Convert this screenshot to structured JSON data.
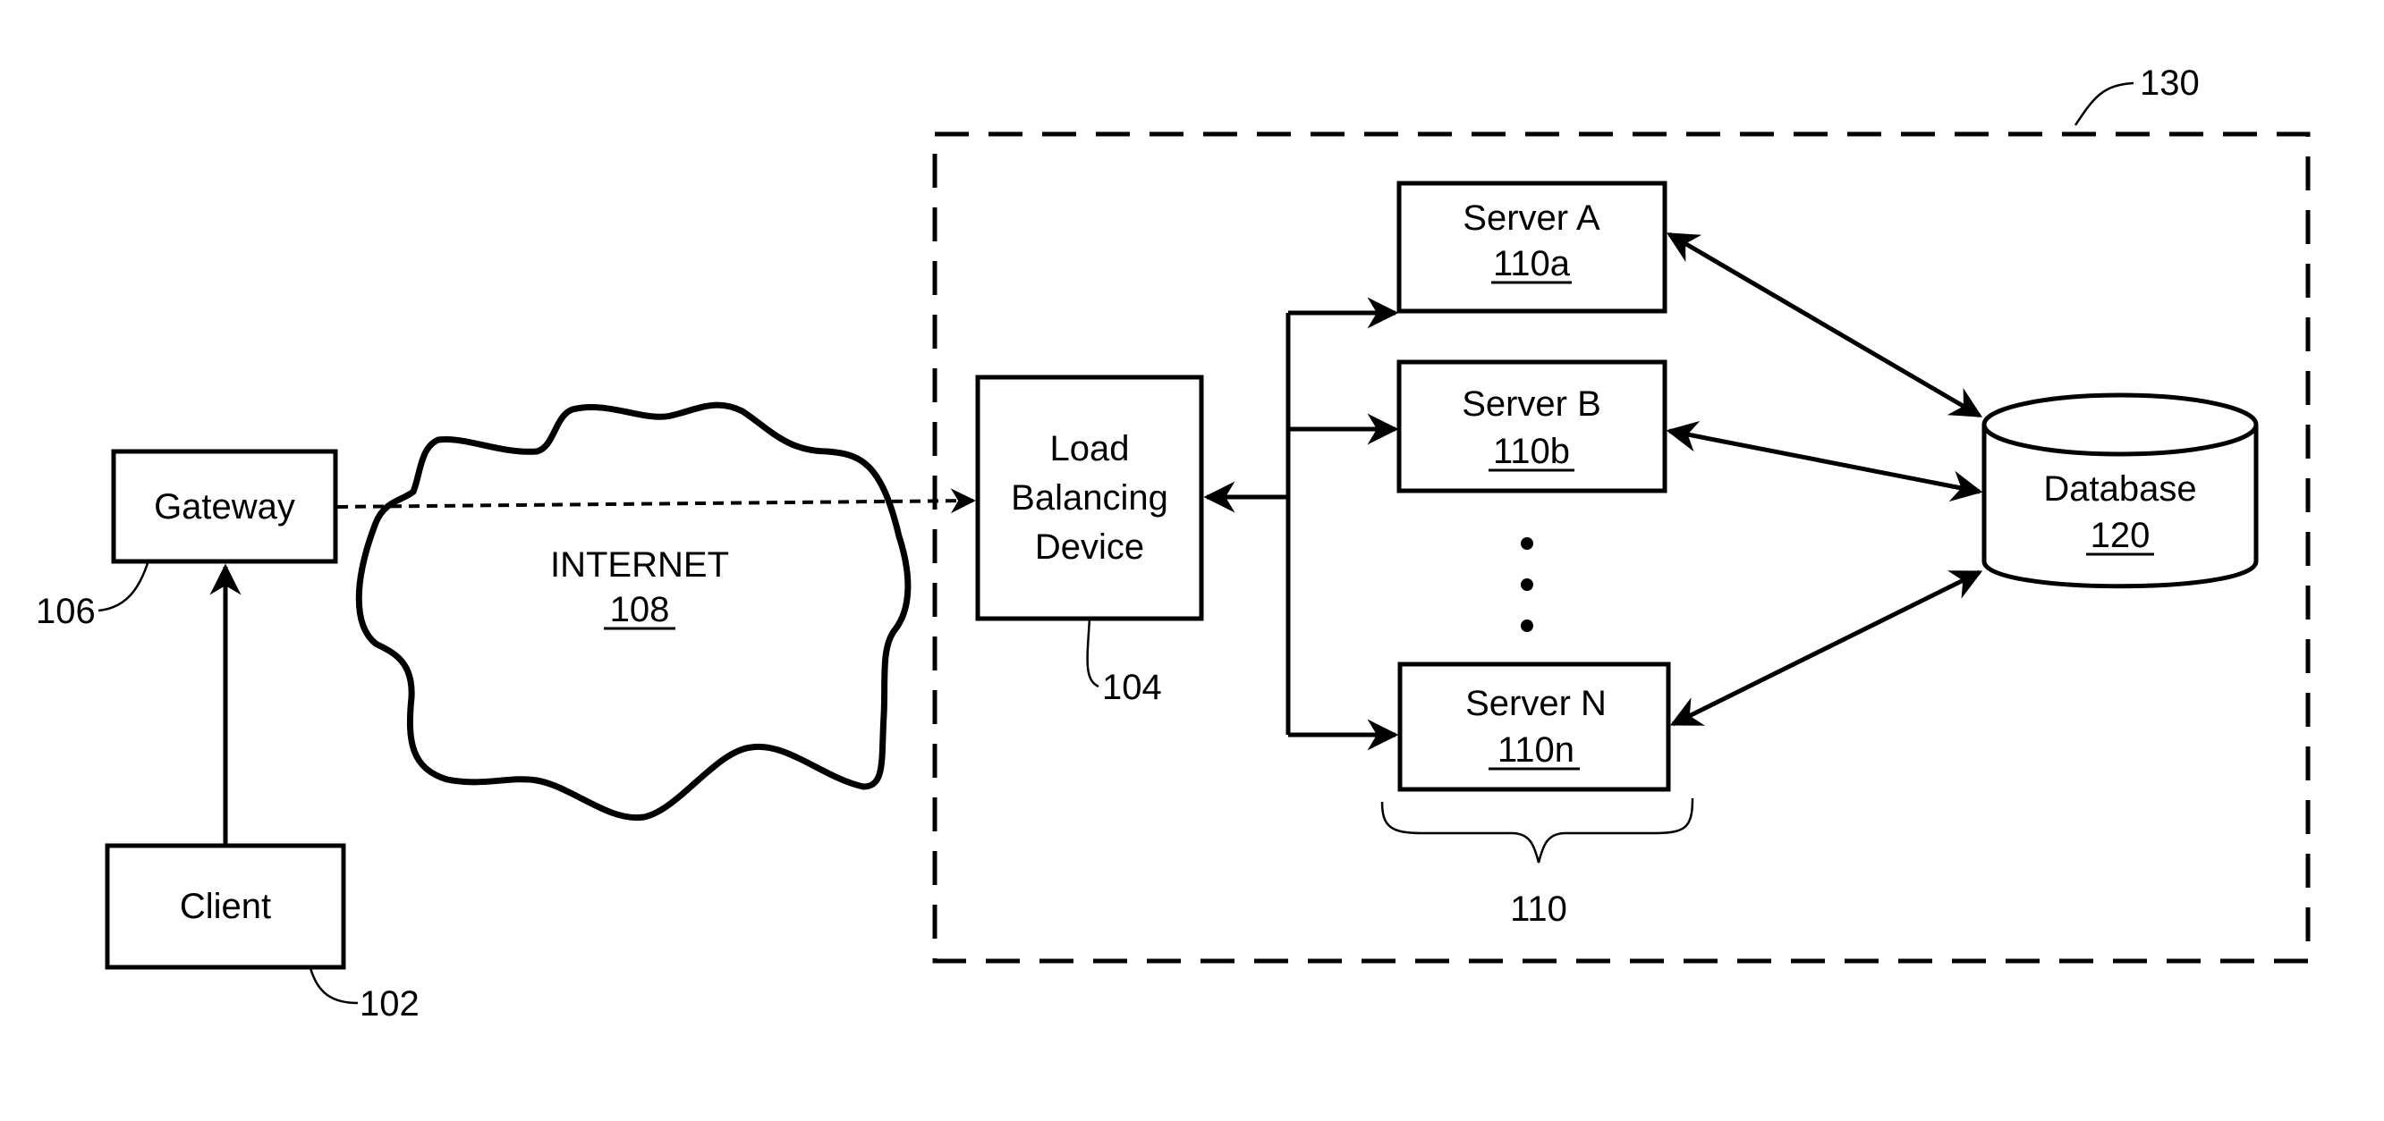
{
  "diagram": {
    "system_ref": "130",
    "client": {
      "label": "Client",
      "ref": "102"
    },
    "gateway": {
      "label": "Gateway",
      "ref": "106"
    },
    "internet": {
      "label": "INTERNET",
      "ref": "108"
    },
    "load_balancer": {
      "lines": [
        "Load",
        "Balancing",
        "Device"
      ],
      "ref": "104"
    },
    "servers": [
      {
        "label": "Server A",
        "ref": "110a"
      },
      {
        "label": "Server B",
        "ref": "110b"
      },
      {
        "label": "Server N",
        "ref": "110n"
      }
    ],
    "server_group_ref": "110",
    "database": {
      "label": "Database",
      "ref": "120"
    },
    "edges": [
      {
        "from": "Client",
        "to": "Gateway",
        "style": "solid"
      },
      {
        "from": "Gateway",
        "to": "Load Balancing Device",
        "style": "dashed",
        "via": "INTERNET"
      },
      {
        "from": "Load Balancing Device",
        "to": "Server A",
        "style": "solid"
      },
      {
        "from": "Load Balancing Device",
        "to": "Server B",
        "style": "solid"
      },
      {
        "from": "Load Balancing Device",
        "to": "Server N",
        "style": "solid"
      },
      {
        "from": "Server A",
        "to": "Database",
        "style": "bidirectional"
      },
      {
        "from": "Server B",
        "to": "Database",
        "style": "bidirectional"
      },
      {
        "from": "Server N",
        "to": "Database",
        "style": "bidirectional"
      }
    ]
  }
}
